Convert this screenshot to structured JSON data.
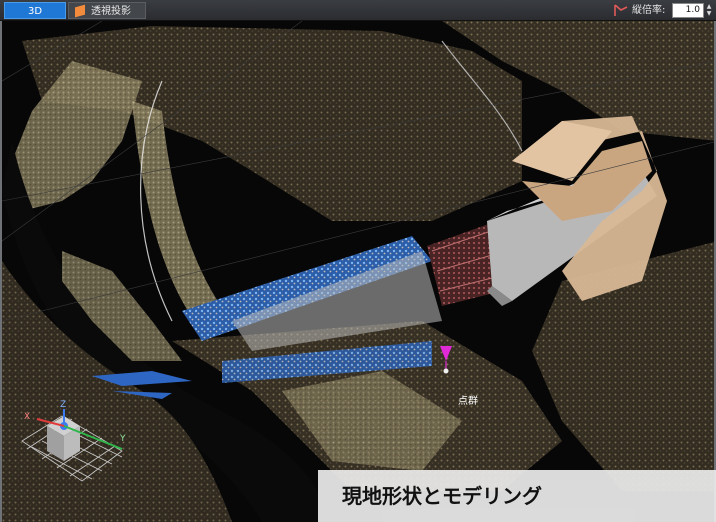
{
  "toolbar": {
    "tab_3d": "3D",
    "tab_perspective": "透視投影",
    "vertical_scale_label": "縦倍率:",
    "vertical_scale_value": "1.0"
  },
  "viewport": {
    "point_label": "点群",
    "axis": {
      "x": "X",
      "y": "Y",
      "z": "Z"
    }
  },
  "caption": "現地形状とモデリング",
  "colors": {
    "active_tab": "#1f78d6",
    "marker": "#e02ad6"
  }
}
